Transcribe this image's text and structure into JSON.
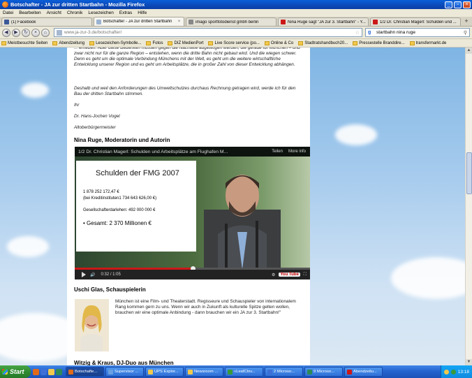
{
  "window": {
    "title": "Botschafter - JA zur dritten Startbahn - Mozilla Firefox"
  },
  "menu": [
    "Datei",
    "Bearbeiten",
    "Ansicht",
    "Chronik",
    "Lesezeichen",
    "Extras",
    "Hilfe"
  ],
  "tabs": [
    {
      "label": "(1) Facebook",
      "color": "#3b5998",
      "active": false
    },
    {
      "label": "Botschafter - JA zur dritten Startbahn",
      "color": "#9bb3d0",
      "active": true
    },
    {
      "label": "imago sportfotodienst gmbh berlin",
      "color": "#888888",
      "active": false
    },
    {
      "label": "Nina Ruge sagt \"JA zur 3. Startbahn\" - Y...",
      "color": "#cc1818",
      "active": false
    },
    {
      "label": "1/2 Dr. Christian Magerl: Schulden und ...",
      "color": "#cc1818",
      "active": false
    }
  ],
  "nav": {
    "url_domain": "www.ja-zur-3.de",
    "url_path": "/botschafter/",
    "search_value": "startbahn nina ruge"
  },
  "bookmarks": [
    "Meistbesuchte Seiten",
    "Abendzeitung",
    "Lesezeichen-Symbolle...",
    "Fotos",
    "DIZ MedienPort",
    "Live Score service (po...",
    "Online & Co",
    "Stadtratshandbuch20...",
    "Pressestelle Branddire...",
    "transfermarkt.de"
  ],
  "page": {
    "intro_partial": "... erheben. Aber diese Bedenken müssen gegen die Nachteile abgewogen werden, die gerade für München – und zwar nicht nur für die ganze Region – entstehen, wenn die dritte Bahn nicht gebaut wird. Und die wiegen schwer. Denn es geht um die optimale Verbindung Münchens mit der Welt, es geht um die weitere wirtschaftliche Entwicklung unserer Region und es geht um Arbeitsplätze, die in großer Zahl von dieser Entwicklung abhängen.",
    "paragraph2": "Deshalb und weil den Anforderungen des Umweltschutzes durchaus Rechnung getragen wird, werde ich für den Bau der dritten Startbahn stimmen.",
    "signoff1": "Ihr",
    "signoff2": "Dr. Hans-Jochen Vogel",
    "signoff3": "Altoberbürgermeister",
    "heading_ruge": "Nina Ruge, Moderatorin und Autorin",
    "video": {
      "title": "1/2 Dr. Christian Magerl: Schulden und Arbeitsplätze am Flughafen M...",
      "share_label": "Teilen",
      "more_label": "More info",
      "slide_title": "Schulden der FMG 2007",
      "slide_line1": "1 878 252 172,47 €",
      "slide_line2": "(bei Kreditinstituten1 734 643 626,00 €)",
      "slide_line3": "Gesellschafterdarlehen: 492 000 000 €",
      "slide_line4": "•  Gesamt: 2 370 Millionen €",
      "time": "0:32 / 1:05",
      "progress": 0.5,
      "yt_label": "You Tube"
    },
    "heading_glas": "Uschi Glas, Schauspielerin",
    "glas_text": "München ist eine Film- und Theaterstadt. Regisseure und Schauspieler von internationalem Rang kommen gern zu uns. Wenn wir auch in Zukunft als kulturelle Spitze gelten wollen, brauchen wir eine optimale Anbindung - dann brauchen wir ein JA zur 3. Startbahn!\"",
    "heading_witzig": "Witzig & Kraus, DJ-Duo aus München"
  },
  "taskbar": {
    "start_label": "Start",
    "tasks": [
      {
        "label": "Botschafte...",
        "color": "#e06a1a",
        "active": true
      },
      {
        "label": "Supervisor ...",
        "color": "#6aa0e0",
        "active": false
      },
      {
        "label": "UPS Explor...",
        "color": "#f2c94c",
        "active": false
      },
      {
        "label": "Newsroom ...",
        "color": "#f2c94c",
        "active": false
      },
      {
        "label": "«LeafClov...",
        "color": "#3a9a3a",
        "active": false
      },
      {
        "label": "2 Microso...",
        "color": "#3d6fd6",
        "active": false
      },
      {
        "label": "9 Microso...",
        "color": "#2e8b57",
        "active": false
      },
      {
        "label": "Abendzeitu...",
        "color": "#cc1818",
        "active": false
      }
    ],
    "clock": "13:18"
  }
}
